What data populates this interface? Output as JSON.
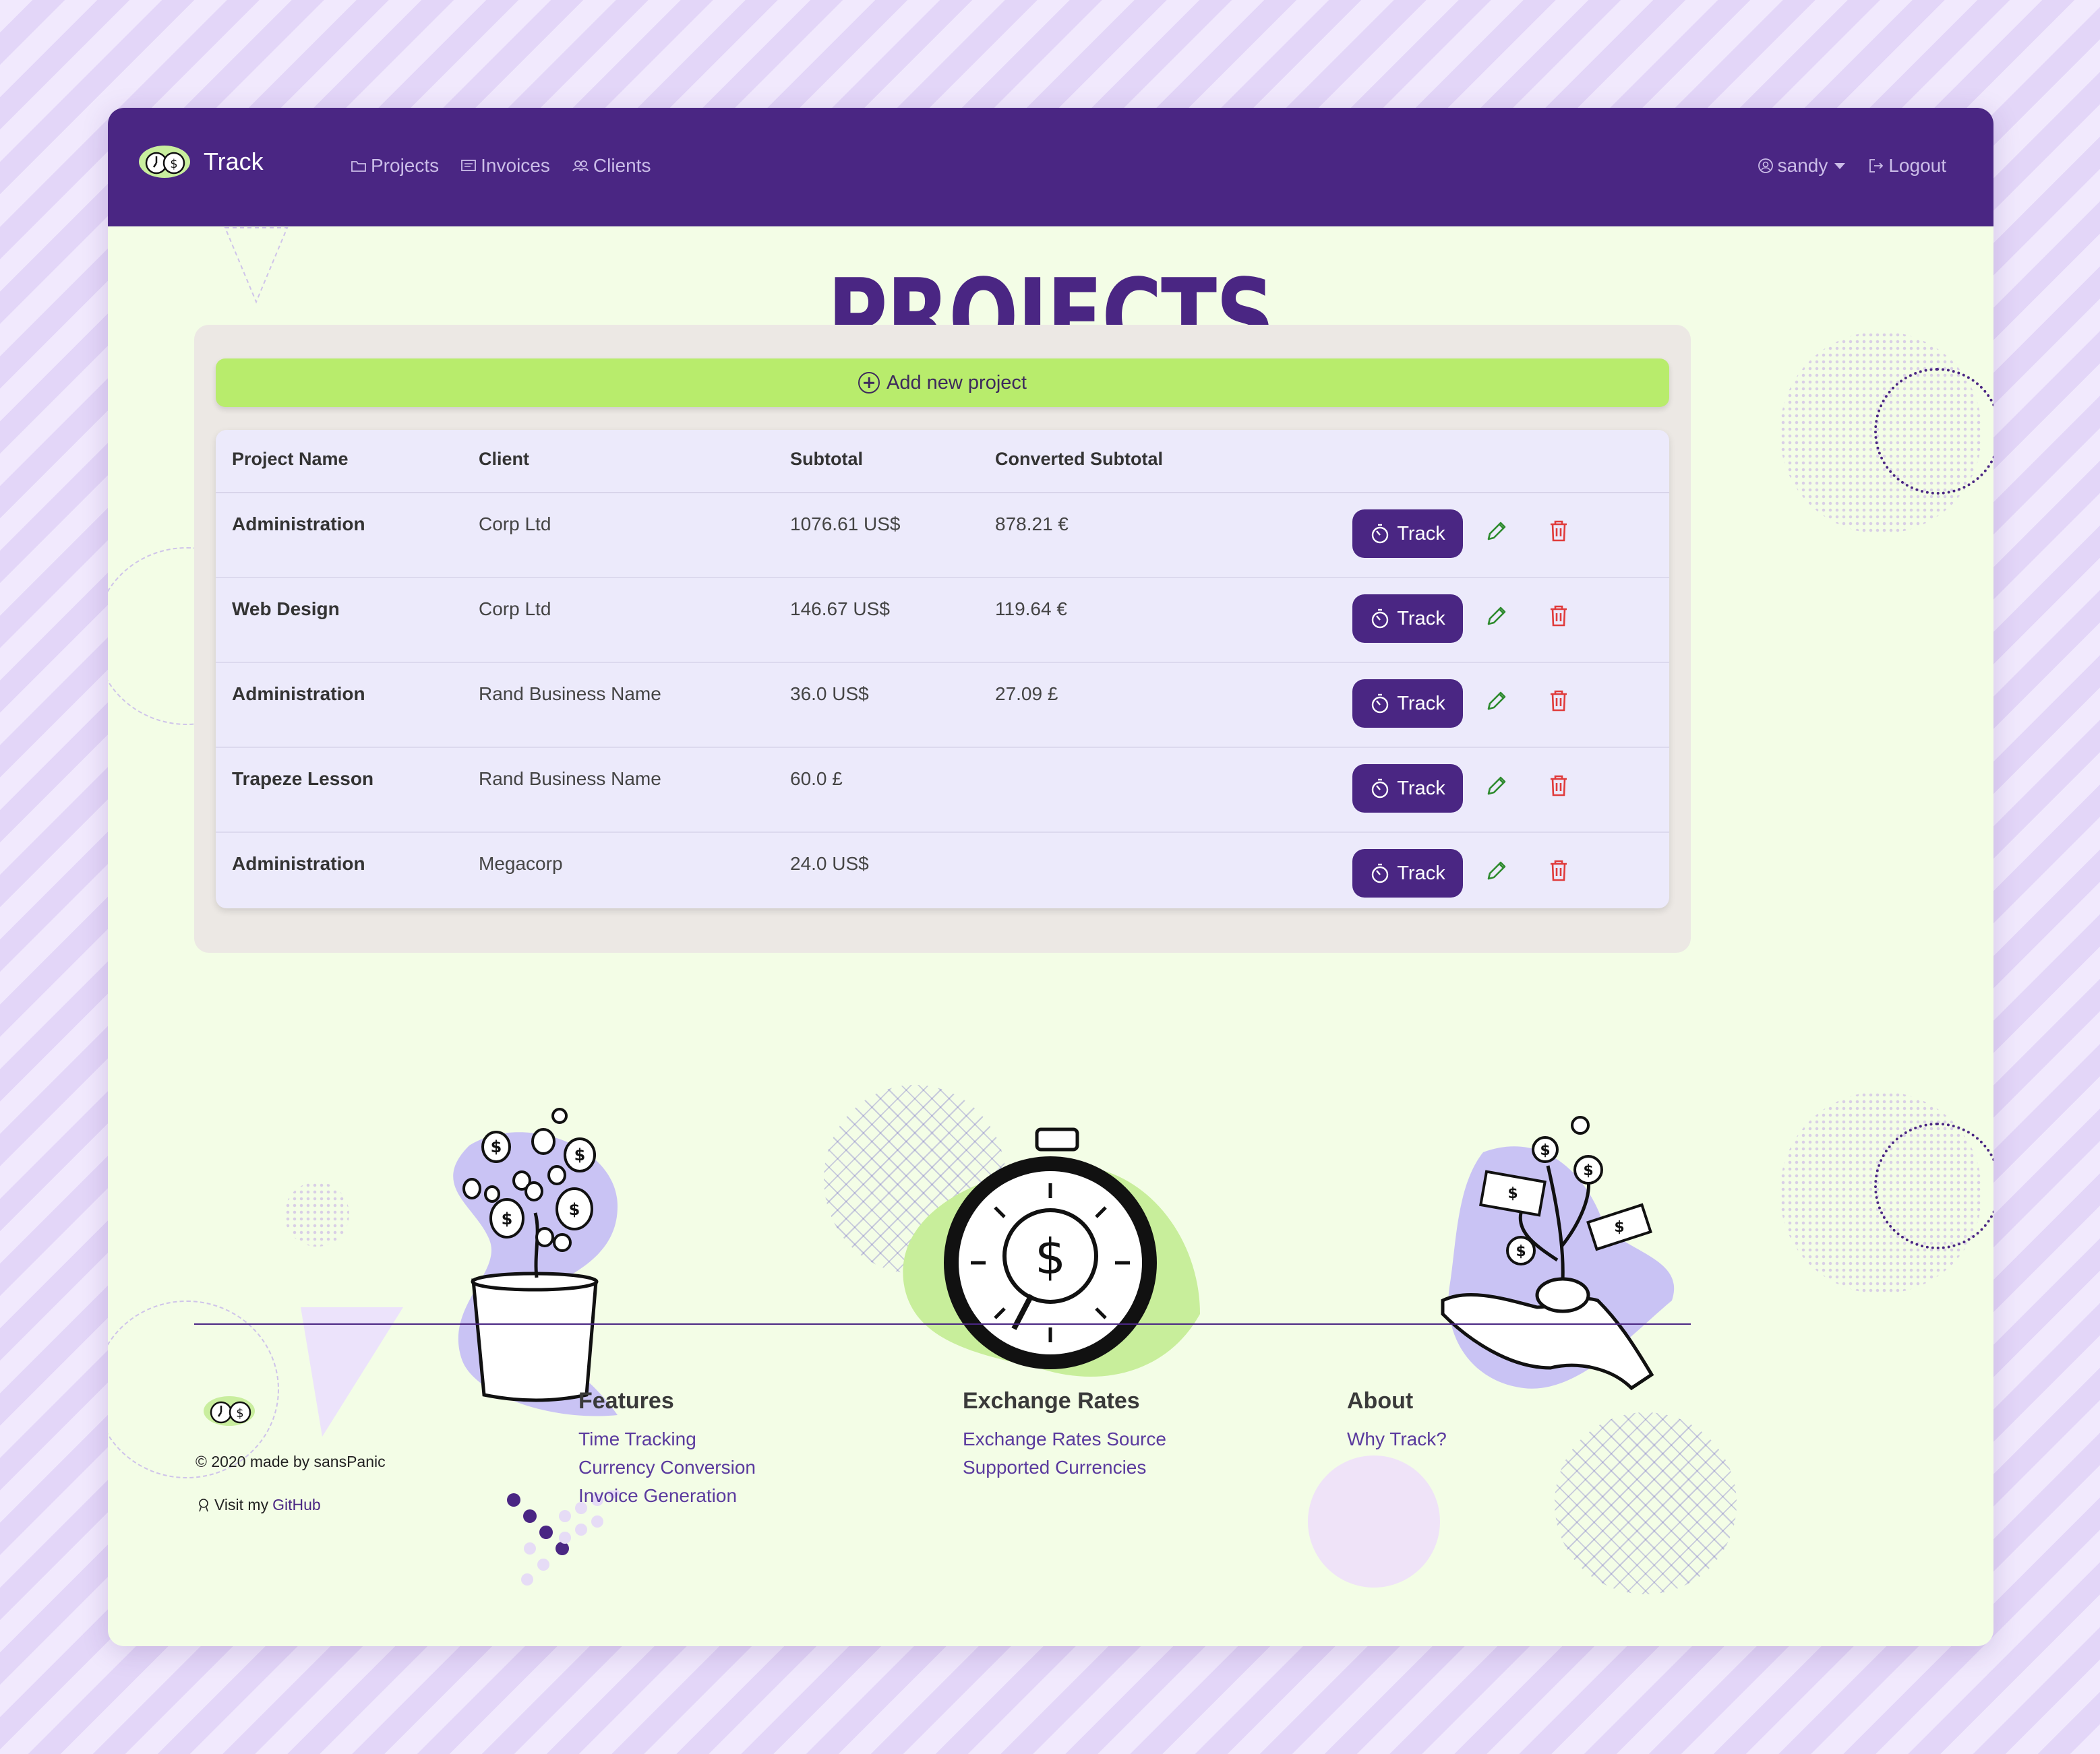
{
  "nav": {
    "brand": "Track",
    "links": [
      "Projects",
      "Invoices",
      "Clients"
    ],
    "user": "sandy",
    "logout": "Logout"
  },
  "page": {
    "title": "PROJECTS",
    "add_button": "Add new project"
  },
  "table": {
    "columns": [
      "Project Name",
      "Client",
      "Subtotal",
      "Converted Subtotal"
    ],
    "rows": [
      {
        "name": "Administration",
        "client": "Corp Ltd",
        "subtotal": "1076.61 US$",
        "converted": "878.21 €",
        "action": "Track"
      },
      {
        "name": "Web Design",
        "client": "Corp Ltd",
        "subtotal": "146.67 US$",
        "converted": "119.64 €",
        "action": "Track"
      },
      {
        "name": "Administration",
        "client": "Rand Business Name",
        "subtotal": "36.0 US$",
        "converted": "27.09 £",
        "action": "Track"
      },
      {
        "name": "Trapeze Lesson",
        "client": "Rand Business Name",
        "subtotal": "60.0 £",
        "converted": "",
        "action": "Track"
      },
      {
        "name": "Administration",
        "client": "Megacorp",
        "subtotal": "24.0 US$",
        "converted": "",
        "action": "Track"
      }
    ]
  },
  "footer": {
    "copyright": "© 2020 made by sansPanic",
    "github_prefix": "Visit my",
    "github_link": "GitHub",
    "features": {
      "heading": "Features",
      "links": [
        "Time Tracking",
        "Currency Conversion",
        "Invoice Generation"
      ]
    },
    "rates": {
      "heading": "Exchange Rates",
      "links": [
        "Exchange Rates Source",
        "Supported Currencies"
      ]
    },
    "about": {
      "heading": "About",
      "links": [
        "Why Track?"
      ]
    }
  },
  "colors": {
    "primary": "#4a2683",
    "accent": "#b8ec6c",
    "background": "#f3fde6",
    "danger": "#e03b3b",
    "edit": "#2e8b2e"
  },
  "icons": [
    "logo-icon",
    "folder-icon",
    "invoice-icon",
    "clients-icon",
    "user-icon",
    "logout-icon",
    "plus-circle-icon",
    "stopwatch-icon",
    "pencil-icon",
    "trash-icon",
    "github-icon"
  ]
}
